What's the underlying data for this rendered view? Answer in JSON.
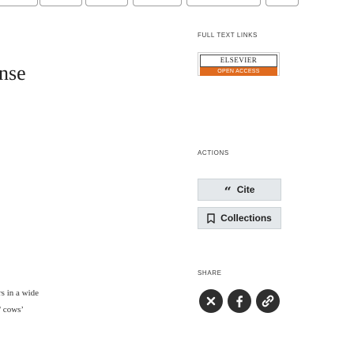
{
  "left": {
    "word": "nse",
    "line1": "rs in a wide",
    "line2": "/ cows’",
    "tail": "."
  },
  "full_text": {
    "label": "FULL TEXT LINKS",
    "badge_top": "ELSEVIER",
    "badge_bottom": "OPEN ACCESS",
    "badge_color": "#e06b1f"
  },
  "actions": {
    "label": "ACTIONS",
    "cite_label": "Cite",
    "collections_label": "Collections"
  },
  "share": {
    "label": "SHARE",
    "icons": [
      "email-icon",
      "facebook-icon",
      "share-icon"
    ]
  }
}
